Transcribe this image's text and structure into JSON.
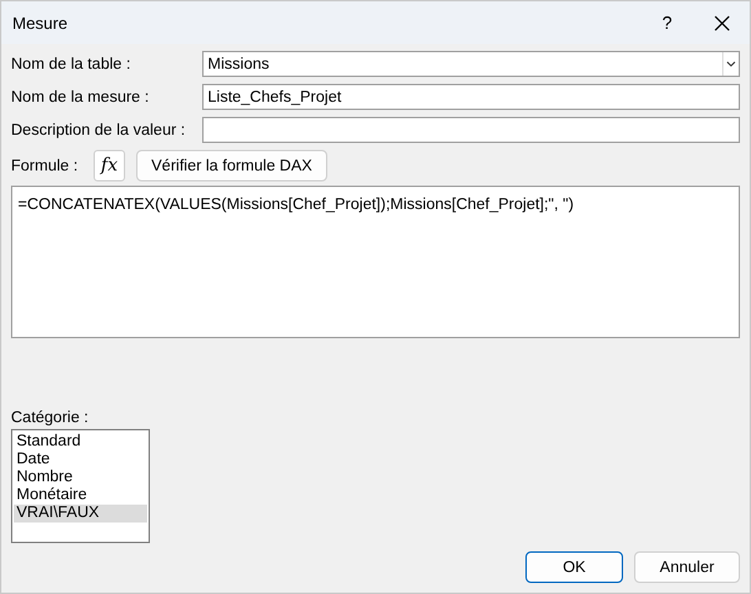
{
  "window": {
    "title": "Mesure",
    "help": "?"
  },
  "fields": [
    {
      "label": "Nom de la table :",
      "value": "Missions",
      "kind": "dropdown"
    },
    {
      "label": "Nom de la mesure :",
      "value": "Liste_Chefs_Projet",
      "kind": "text"
    },
    {
      "label": "Description de la valeur :",
      "kind": "text"
    }
  ],
  "formula": {
    "label": "Formule :",
    "fx": "fx",
    "check_button": "Vérifier la formule DAX",
    "value": "=CONCATENATEX(VALUES(Missions[Chef_Projet]);Missions[Chef_Projet];\", \")"
  },
  "category": {
    "label": "Catégorie :",
    "items": [
      {
        "label": "Standard",
        "selected": false
      },
      {
        "label": "Date",
        "selected": false
      },
      {
        "label": "Nombre",
        "selected": false
      },
      {
        "label": "Monétaire",
        "selected": false
      },
      {
        "label": "VRAI\\FAUX",
        "selected": true
      }
    ]
  },
  "buttons": [
    {
      "label": "OK",
      "default": true
    },
    {
      "label": "Annuler",
      "default": false
    }
  ]
}
